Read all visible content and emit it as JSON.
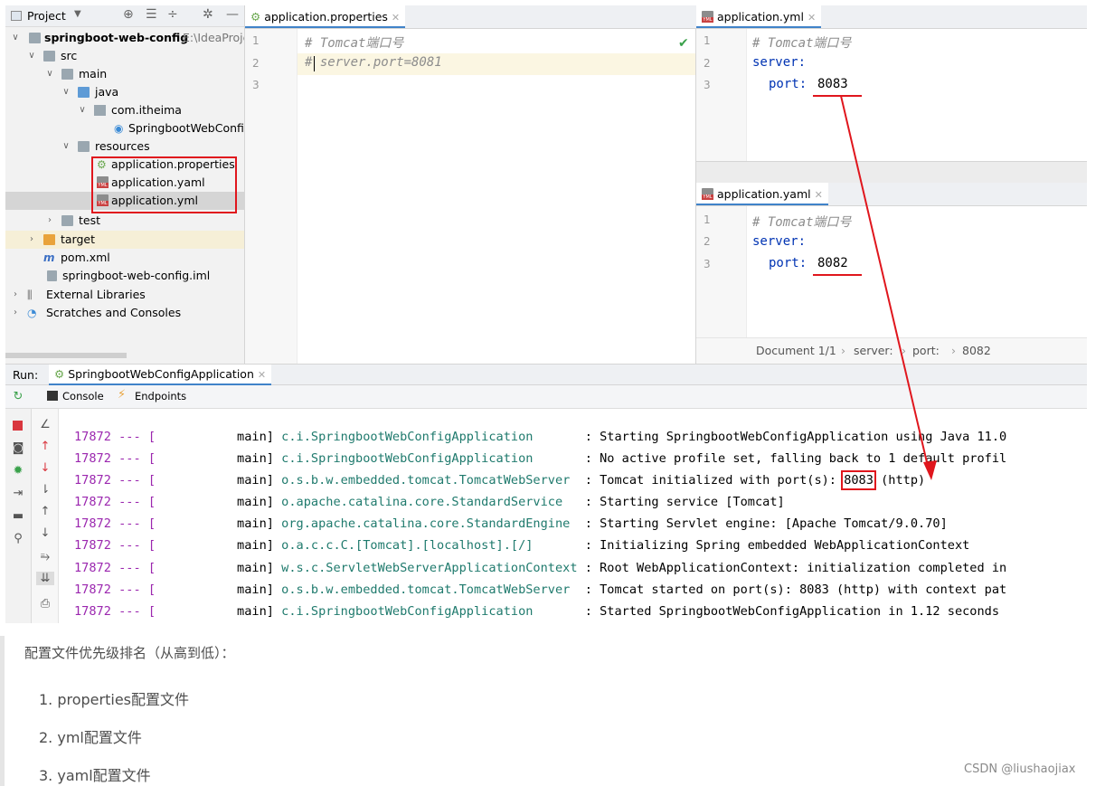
{
  "project_panel": {
    "title": "Project",
    "tree": [
      {
        "label": "springboot-web-config",
        "suffix": "E:\\IdeaProje",
        "bold": true
      },
      {
        "label": "src"
      },
      {
        "label": "main"
      },
      {
        "label": "java"
      },
      {
        "label": "com.itheima"
      },
      {
        "label": "SpringbootWebConfi"
      },
      {
        "label": "resources"
      },
      {
        "label": "application.properties"
      },
      {
        "label": "application.yaml"
      },
      {
        "label": "application.yml"
      },
      {
        "label": "test"
      },
      {
        "label": "target"
      },
      {
        "label": "pom.xml"
      },
      {
        "label": "springboot-web-config.iml"
      },
      {
        "label": "External Libraries"
      },
      {
        "label": "Scratches and Consoles"
      }
    ]
  },
  "editors": {
    "properties": {
      "tab": "application.properties",
      "lines": [
        "# Tomcat端口号",
        "# server.port=8081",
        ""
      ],
      "line_numbers": [
        "1",
        "2",
        "3"
      ]
    },
    "yml": {
      "tab": "application.yml",
      "comment": "# Tomcat端口号",
      "key": "server:",
      "port_key": "port:",
      "port_value": "8083",
      "line_numbers": [
        "1",
        "2",
        "3"
      ]
    },
    "yaml": {
      "tab": "application.yaml",
      "comment": "# Tomcat端口号",
      "key": "server:",
      "port_key": "port:",
      "port_value": "8082",
      "line_numbers": [
        "1",
        "2",
        "3"
      ]
    },
    "breadcrumb": {
      "doc": "Document 1/1",
      "items": [
        "server:",
        "port:",
        "8082"
      ]
    }
  },
  "run_panel": {
    "label": "Run:",
    "config": "SpringbootWebConfigApplication",
    "tabs": [
      "Console",
      "Endpoints"
    ],
    "logs": [
      {
        "pid": "17872 --- [",
        "thread": "           main]",
        "cls": "c.i.SpringbootWebConfigApplication      ",
        "msg": ": Starting SpringbootWebConfigApplication using Java 11.0"
      },
      {
        "pid": "17872 --- [",
        "thread": "           main]",
        "cls": "c.i.SpringbootWebConfigApplication      ",
        "msg": ": No active profile set, falling back to 1 default profil"
      },
      {
        "pid": "17872 --- [",
        "thread": "           main]",
        "cls": "o.s.b.w.embedded.tomcat.TomcatWebServer ",
        "msg_pre": ": Tomcat initialized with port(s): ",
        "port": "8083",
        "msg_post": " (http)"
      },
      {
        "pid": "17872 --- [",
        "thread": "           main]",
        "cls": "o.apache.catalina.core.StandardService  ",
        "msg": ": Starting service [Tomcat]"
      },
      {
        "pid": "17872 --- [",
        "thread": "           main]",
        "cls": "org.apache.catalina.core.StandardEngine ",
        "msg": ": Starting Servlet engine: [Apache Tomcat/9.0.70]"
      },
      {
        "pid": "17872 --- [",
        "thread": "           main]",
        "cls": "o.a.c.c.C.[Tomcat].[localhost].[/]      ",
        "msg": ": Initializing Spring embedded WebApplicationContext"
      },
      {
        "pid": "17872 --- [",
        "thread": "           main]",
        "cls": "w.s.c.ServletWebServerApplicationContext",
        "msg": ": Root WebApplicationContext: initialization completed in"
      },
      {
        "pid": "17872 --- [",
        "thread": "           main]",
        "cls": "o.s.b.w.embedded.tomcat.TomcatWebServer ",
        "msg": ": Tomcat started on port(s): 8083 (http) with context pat"
      },
      {
        "pid": "17872 --- [",
        "thread": "           main]",
        "cls": "c.i.SpringbootWebConfigApplication      ",
        "msg": ": Started SpringbootWebConfigApplication in 1.12 seconds"
      }
    ]
  },
  "article": {
    "heading": "配置文件优先级排名（从高到低）：",
    "items": [
      "1. properties配置文件",
      "2. yml配置文件",
      "3. yaml配置文件"
    ],
    "watermark": "CSDN @liushaojiax"
  },
  "colors": {
    "annotation": "#e0161d",
    "keyword": "#0033b3",
    "class": "#1f7a6d",
    "pid": "#9b27af"
  }
}
